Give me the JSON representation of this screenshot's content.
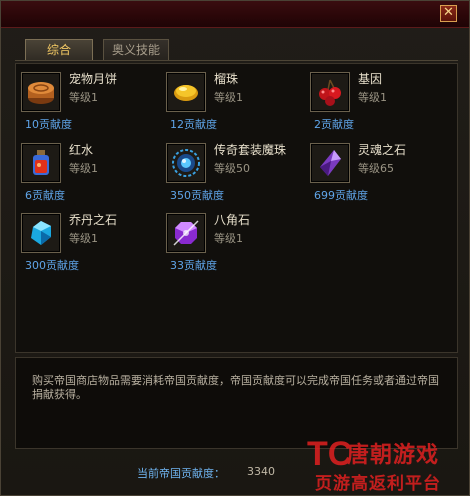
{
  "window": {
    "close_glyph": "✕"
  },
  "tabs": [
    {
      "label": "综合",
      "active": true
    },
    {
      "label": "奥义技能",
      "active": false
    }
  ],
  "items": [
    {
      "name": "宠物月饼",
      "level": "等级1",
      "cost": "10贡献度",
      "icon": "mooncake-icon"
    },
    {
      "name": "榴珠",
      "level": "等级1",
      "cost": "12贡献度",
      "icon": "gold-bead-icon"
    },
    {
      "name": "基因",
      "level": "等级1",
      "cost": "2贡献度",
      "icon": "gene-berries-icon"
    },
    {
      "name": "红水",
      "level": "等级1",
      "cost": "6贡献度",
      "icon": "red-potion-icon"
    },
    {
      "name": "传奇套装魔珠",
      "level": "等级50",
      "cost": "350贡献度",
      "icon": "blue-orb-icon"
    },
    {
      "name": "灵魂之石",
      "level": "等级65",
      "cost": "699贡献度",
      "icon": "soul-crystal-icon"
    },
    {
      "name": "乔丹之石",
      "level": "等级1",
      "cost": "300贡献度",
      "icon": "blue-gem-icon"
    },
    {
      "name": "八角石",
      "level": "等级1",
      "cost": "33贡献度",
      "icon": "purple-octagon-icon"
    }
  ],
  "description": "购买帝国商店物品需要消耗帝国贡献度，帝国贡献度可以完成帝国任务或者通过帝国捐献获得。",
  "balance": {
    "label": "当前帝国贡献度：",
    "value": "3340"
  },
  "watermark": {
    "logo": "TC",
    "title": "唐朝游戏",
    "subtitle": "页游高返利平台"
  },
  "colors": {
    "accent_gold": "#f3c964",
    "cost_blue": "#5fa4e8",
    "watermark_red": "#e02020"
  }
}
